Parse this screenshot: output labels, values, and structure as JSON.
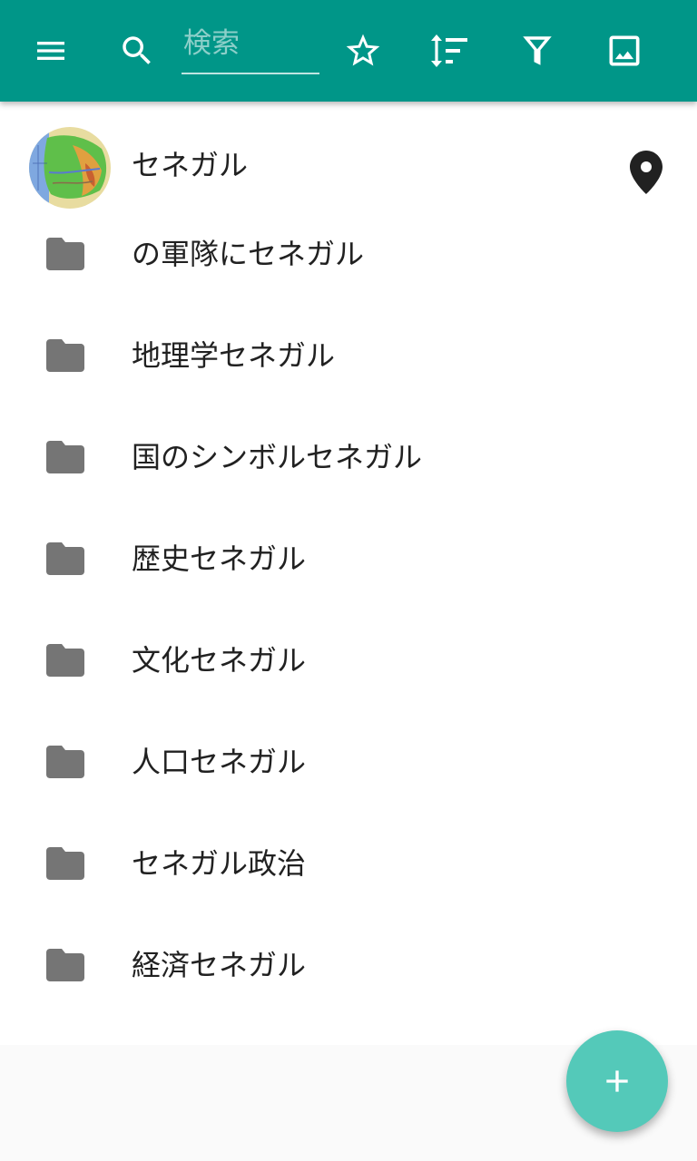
{
  "toolbar": {
    "search": {
      "placeholder": "検索",
      "value": ""
    },
    "icons": [
      "menu-icon",
      "search-icon",
      "star-outline-icon",
      "sort-icon",
      "filter-icon",
      "image-icon"
    ],
    "color": "#009688"
  },
  "header_item": {
    "title": "セネガル",
    "avatar": "senegal-map-thumbnail",
    "trailing_icon": "map-marker-icon"
  },
  "categories": [
    {
      "label": "の軍隊にセネガル",
      "icon": "folder-icon"
    },
    {
      "label": "地理学セネガル",
      "icon": "folder-icon"
    },
    {
      "label": "国のシンボルセネガル",
      "icon": "folder-icon"
    },
    {
      "label": "歴史セネガル",
      "icon": "folder-icon"
    },
    {
      "label": "文化セネガル",
      "icon": "folder-icon"
    },
    {
      "label": "人口セネガル",
      "icon": "folder-icon"
    },
    {
      "label": "セネガル政治",
      "icon": "folder-icon"
    },
    {
      "label": "経済セネガル",
      "icon": "folder-icon"
    }
  ],
  "fab": {
    "icon": "plus-icon",
    "color": "#54c9b9"
  }
}
